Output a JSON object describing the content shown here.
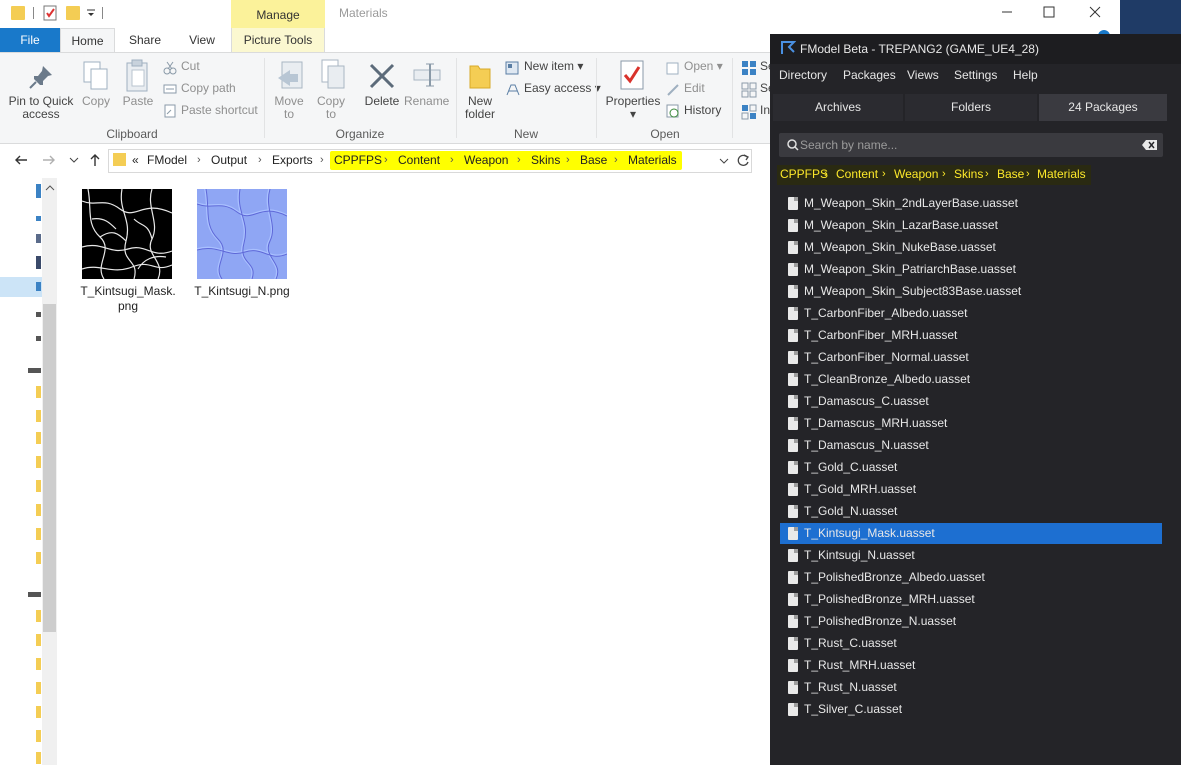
{
  "explorer": {
    "window_title": "Materials",
    "manage_tab": "Manage",
    "tabs": {
      "file": "File",
      "home": "Home",
      "share": "Share",
      "view": "View",
      "picture_tools": "Picture Tools"
    },
    "ribbon": {
      "clipboard": {
        "label": "Clipboard",
        "pin": "Pin to Quick access",
        "pin_l1": "Pin to Quick",
        "pin_l2": "access",
        "copy": "Copy",
        "paste": "Paste",
        "cut": "Cut",
        "copy_path": "Copy path",
        "paste_shortcut": "Paste shortcut"
      },
      "organize": {
        "label": "Organize",
        "move_to_l1": "Move",
        "move_to_l2": "to",
        "copy_to_l1": "Copy",
        "copy_to_l2": "to",
        "delete": "Delete",
        "rename": "Rename"
      },
      "new": {
        "label": "New",
        "new_folder_l1": "New",
        "new_folder_l2": "folder",
        "new_item": "New item",
        "easy_access": "Easy access"
      },
      "open": {
        "label": "Open",
        "properties": "Properties",
        "open": "Open",
        "edit": "Edit",
        "history": "History"
      },
      "select": {
        "select_all_partial": "Se",
        "select_none_partial": "Se",
        "invert_partial": "In"
      }
    },
    "address": {
      "overflow": "«",
      "crumbs": [
        "FModel",
        "Output",
        "Exports",
        "CPPFPS",
        "Content",
        "Weapon",
        "Skins",
        "Base",
        "Materials"
      ]
    },
    "files": [
      {
        "name_l1": "T_Kintsugi_Mask.",
        "name_l2": "png"
      },
      {
        "name_l1": "T_Kintsugi_N.png",
        "name_l2": ""
      }
    ],
    "colors": {
      "file_tab": "#1979ca",
      "manage_tab": "#fbf29a",
      "highlight": "#ffff00"
    }
  },
  "fmodel": {
    "title": "FModel Beta - TREPANG2 (GAME_UE4_28)",
    "menu": [
      "Directory",
      "Packages",
      "Views",
      "Settings",
      "Help"
    ],
    "tabs": [
      "Archives",
      "Folders",
      "24 Packages"
    ],
    "search_placeholder": "Search by name...",
    "path": [
      "CPPFPS",
      "Content",
      "Weapon",
      "Skins",
      "Base",
      "Materials"
    ],
    "items": [
      "M_Weapon_Skin_2ndLayerBase.uasset",
      "M_Weapon_Skin_LazarBase.uasset",
      "M_Weapon_Skin_NukeBase.uasset",
      "M_Weapon_Skin_PatriarchBase.uasset",
      "M_Weapon_Skin_Subject83Base.uasset",
      "T_CarbonFiber_Albedo.uasset",
      "T_CarbonFiber_MRH.uasset",
      "T_CarbonFiber_Normal.uasset",
      "T_CleanBronze_Albedo.uasset",
      "T_Damascus_C.uasset",
      "T_Damascus_MRH.uasset",
      "T_Damascus_N.uasset",
      "T_Gold_C.uasset",
      "T_Gold_MRH.uasset",
      "T_Gold_N.uasset",
      "T_Kintsugi_Mask.uasset",
      "T_Kintsugi_N.uasset",
      "T_PolishedBronze_Albedo.uasset",
      "T_PolishedBronze_MRH.uasset",
      "T_PolishedBronze_N.uasset",
      "T_Rust_C.uasset",
      "T_Rust_MRH.uasset",
      "T_Rust_N.uasset",
      "T_Silver_C.uasset"
    ],
    "selected_item": "T_Kintsugi_Mask.uasset",
    "colors": {
      "background": "#242428",
      "selection": "#1d6fd1",
      "path_text": "#fde92a"
    }
  }
}
